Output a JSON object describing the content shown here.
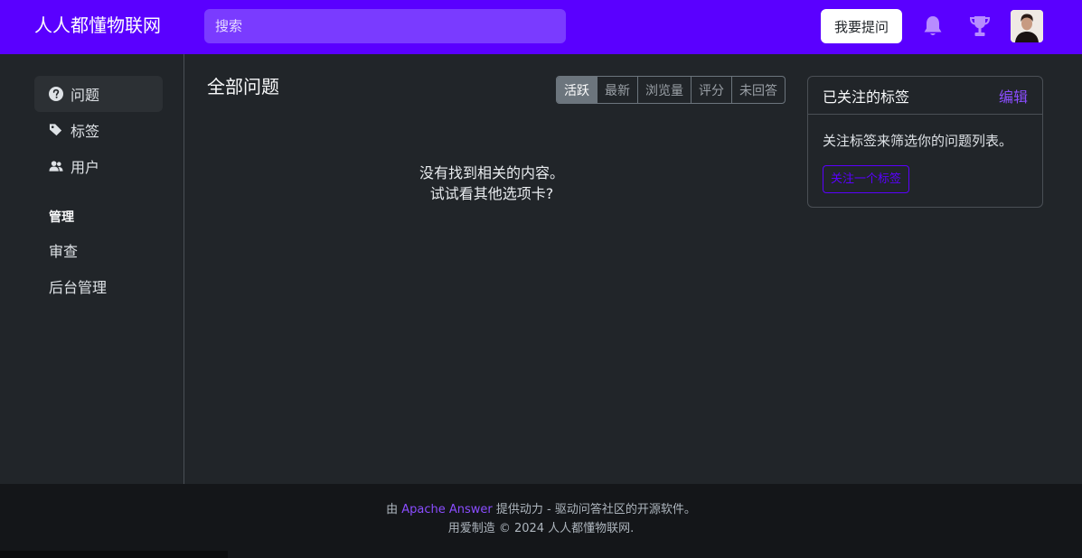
{
  "header": {
    "brand": "人人都懂物联网",
    "search_placeholder": "搜索",
    "ask_button": "我要提问",
    "icons": [
      "bell-icon",
      "trophy-icon"
    ],
    "accent_color": "#5a00ff"
  },
  "sidebar": {
    "items": [
      {
        "label": "问题",
        "icon": "question-circle-icon",
        "active": true
      },
      {
        "label": "标签",
        "icon": "tag-icon",
        "active": false
      },
      {
        "label": "用户",
        "icon": "users-icon",
        "active": false
      }
    ],
    "section_title": "管理",
    "admin_items": [
      {
        "label": "审查"
      },
      {
        "label": "后台管理"
      }
    ]
  },
  "main": {
    "title": "全部问题",
    "sort_tabs": [
      {
        "label": "活跃",
        "active": true
      },
      {
        "label": "最新",
        "active": false
      },
      {
        "label": "浏览量",
        "active": false
      },
      {
        "label": "评分",
        "active": false
      },
      {
        "label": "未回答",
        "active": false
      }
    ],
    "empty_line1": "没有找到相关的内容。",
    "empty_line2": "试试看其他选项卡?"
  },
  "tags_card": {
    "title": "已关注的标签",
    "edit": "编辑",
    "text": "关注标签来筛选你的问题列表。",
    "follow_button": "关注一个标签"
  },
  "footer": {
    "prefix": "由",
    "link": "Apache Answer",
    "suffix": "提供动力 - 驱动问答社区的开源软件。",
    "line2": "用爱制造 © 2024 人人都懂物联网."
  }
}
